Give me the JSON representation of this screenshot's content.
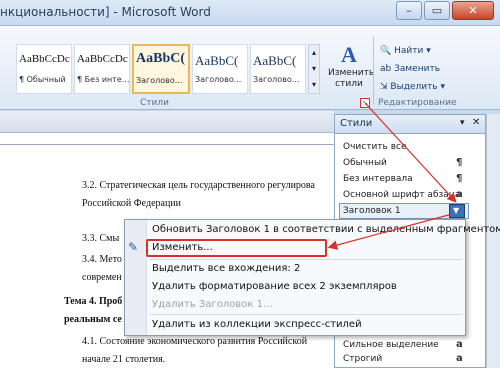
{
  "window": {
    "title": "нкциональности] - Microsoft Word",
    "buttons": [
      "–",
      "▭",
      "✕"
    ]
  },
  "ribbon": {
    "styles": [
      {
        "sample": "AaBbCcDc",
        "name": "¶ Обычный"
      },
      {
        "sample": "AaBbCcDc",
        "name": "¶ Без инте..."
      },
      {
        "sample": "AaBbC(",
        "name": "Заголово..."
      },
      {
        "sample": "AaBbC(",
        "name": "Заголово..."
      },
      {
        "sample": "AaBbC(",
        "name": "Заголово..."
      }
    ],
    "group_styles_label": "Стили",
    "change_styles": "Изменить стили",
    "edit_group": {
      "find": "Найти",
      "replace": "Заменить",
      "select": "Выделить",
      "label": "Редактирование"
    }
  },
  "document": {
    "lines": [
      "3.2. Стратегическая цель государственного регулирова",
      "Российской Федерации",
      "3.3. Смы",
      "3.4. Мето",
      "современ",
      "Тема 4. Проб",
      "реальным се",
      "4.1. Состояние экономического развития Российской",
      "начале 21 столетия."
    ]
  },
  "styles_pane": {
    "title": "Стили",
    "items": [
      {
        "label": "Очистить все",
        "mark": ""
      },
      {
        "label": "Обычный",
        "mark": "¶"
      },
      {
        "label": "Без интервала",
        "mark": "¶"
      },
      {
        "label": "Основной шрифт абзаца",
        "mark": "a"
      },
      {
        "label": "Заголовок 1",
        "mark": ""
      },
      {
        "label": "Сильное выделение",
        "mark": "a"
      },
      {
        "label": "Строгий",
        "mark": "a"
      }
    ]
  },
  "context_menu": {
    "items": [
      {
        "label": "Обновить Заголовок 1 в соответствии с выделенным фрагментом",
        "disabled": false
      },
      {
        "label": "Изменить...",
        "disabled": false
      },
      {
        "label": "Выделить все вхождения: 2",
        "disabled": false
      },
      {
        "label": "Удалить форматирование всех 2 экземпляров",
        "disabled": false
      },
      {
        "label": "Удалить Заголовок 1...",
        "disabled": true
      },
      {
        "label": "Удалить из коллекции экспресс-стилей",
        "disabled": false
      }
    ]
  },
  "colors": {
    "annotation": "#d9312a",
    "ribbon": "#dce8f6",
    "accent": "#3b6fb6"
  }
}
